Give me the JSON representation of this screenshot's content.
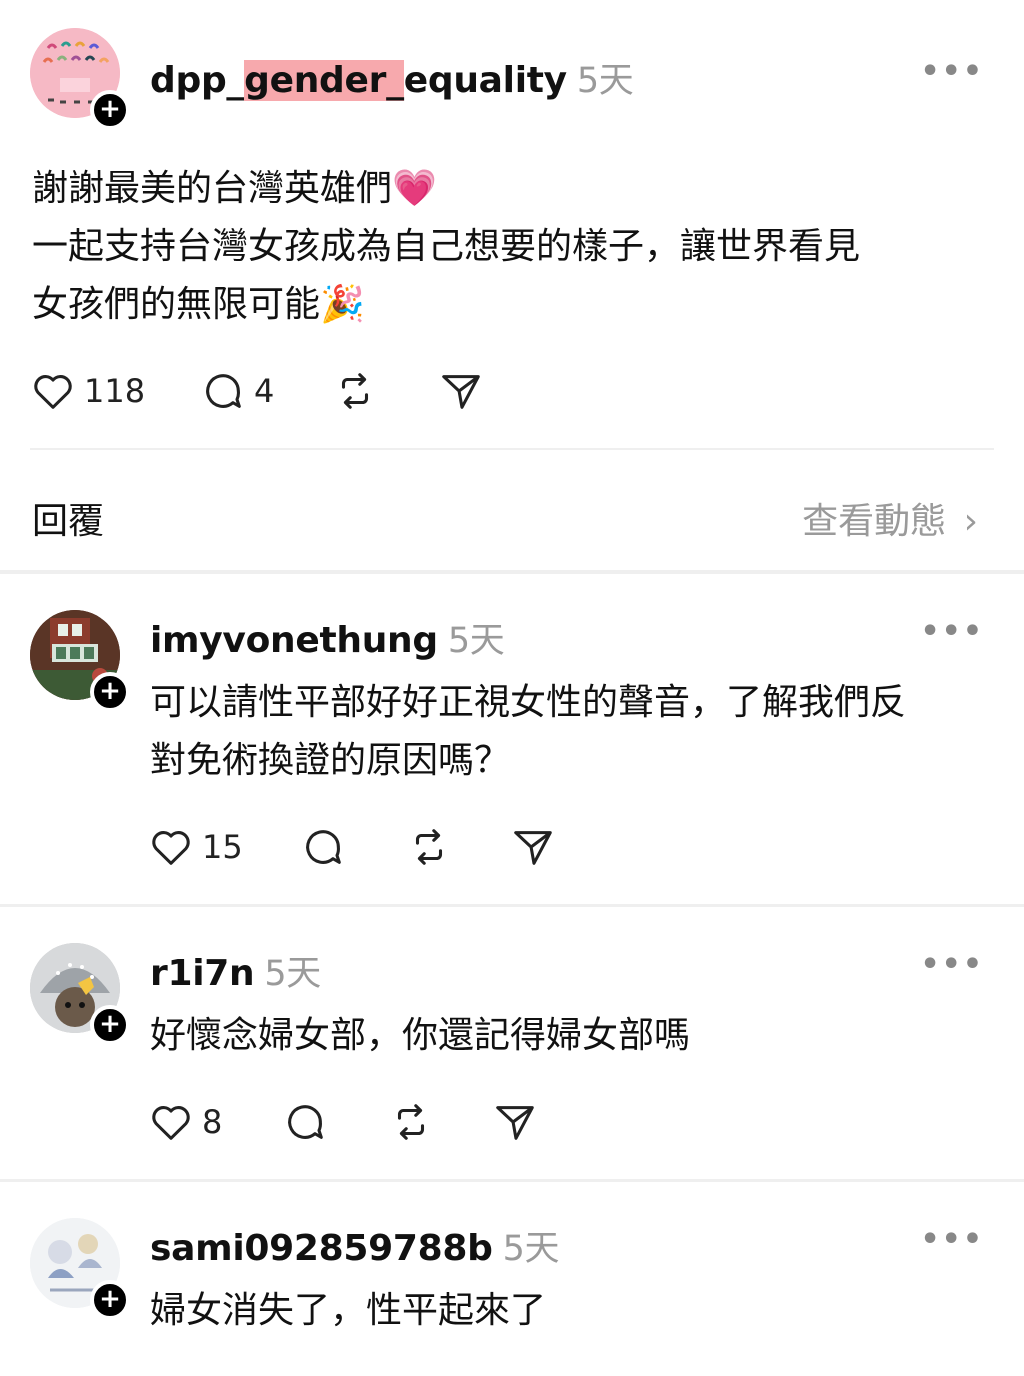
{
  "main_post": {
    "username_parts": [
      "dpp_",
      "gender_",
      "equality"
    ],
    "time": "5天",
    "line1": "謝謝最美的台灣英雄們💗",
    "line2": "一起支持台灣女孩成為自己想要的樣子，讓世界看見",
    "line3": "女孩們的無限可能🎉",
    "likes": "118",
    "comments": "4"
  },
  "replies_header": {
    "label": "回覆",
    "view_activity": "查看動態"
  },
  "replies": [
    {
      "username": "imyvonethung",
      "time": "5天",
      "line1": "可以請性平部好好正視女性的聲音，了解我們反",
      "line2": "對免術換證的原因嗎？",
      "likes": "15"
    },
    {
      "username": "r1i7n",
      "time": "5天",
      "line1": "好懷念婦女部，你還記得婦女部嗎",
      "likes": "8"
    },
    {
      "username": "sami092859788b",
      "time": "5天",
      "line1": "婦女消失了，性平起來了"
    }
  ],
  "icons": {
    "like": "heart-icon",
    "comment": "comment-bubble-icon",
    "repost": "repost-icon",
    "share": "send-icon",
    "more": "more-dots-icon",
    "follow": "plus-icon",
    "chevron": "chevron-right-icon"
  },
  "colors": {
    "text": "#111111",
    "muted": "#9a9a9a",
    "highlight": "#f7a9ad",
    "divider": "#efefef"
  }
}
